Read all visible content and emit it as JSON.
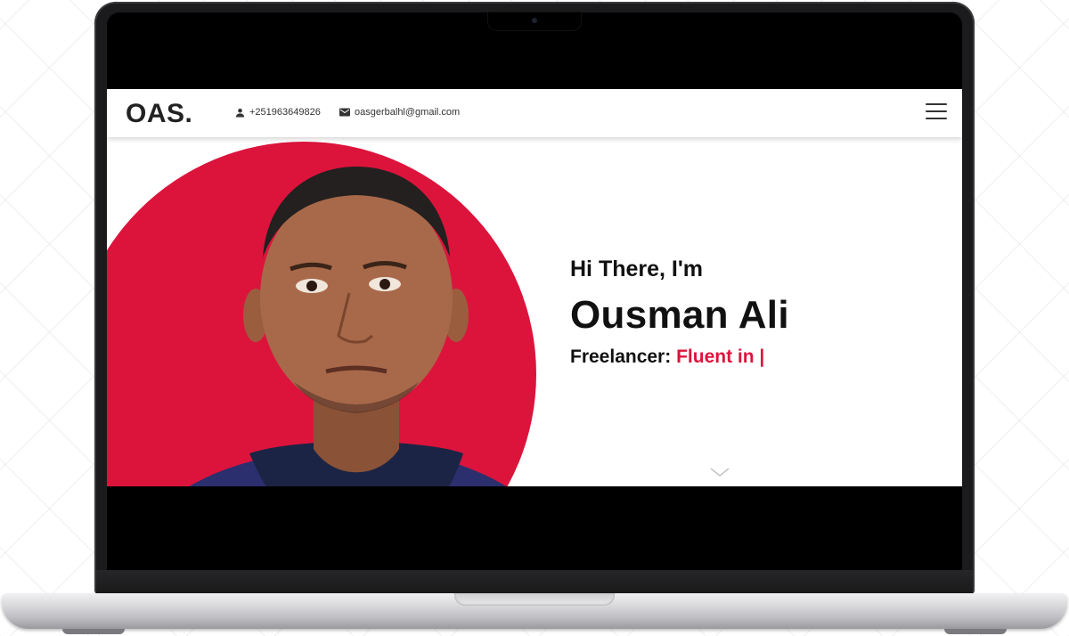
{
  "header": {
    "logo": "OAS.",
    "phone": "+251963649826",
    "email": "oasgerbalhl@gmail.com",
    "phone_icon": "person-icon",
    "email_icon": "mail-icon",
    "menu_icon": "hamburger-menu-icon"
  },
  "hero": {
    "greeting": "Hi There, I'm",
    "name": "Ousman Ali",
    "role_prefix": "Freelancer:",
    "role_typed": "Fluent in |",
    "scroll_icon": "chevron-down-icon"
  },
  "colors": {
    "accent": "#dc143c",
    "text": "#111111"
  }
}
